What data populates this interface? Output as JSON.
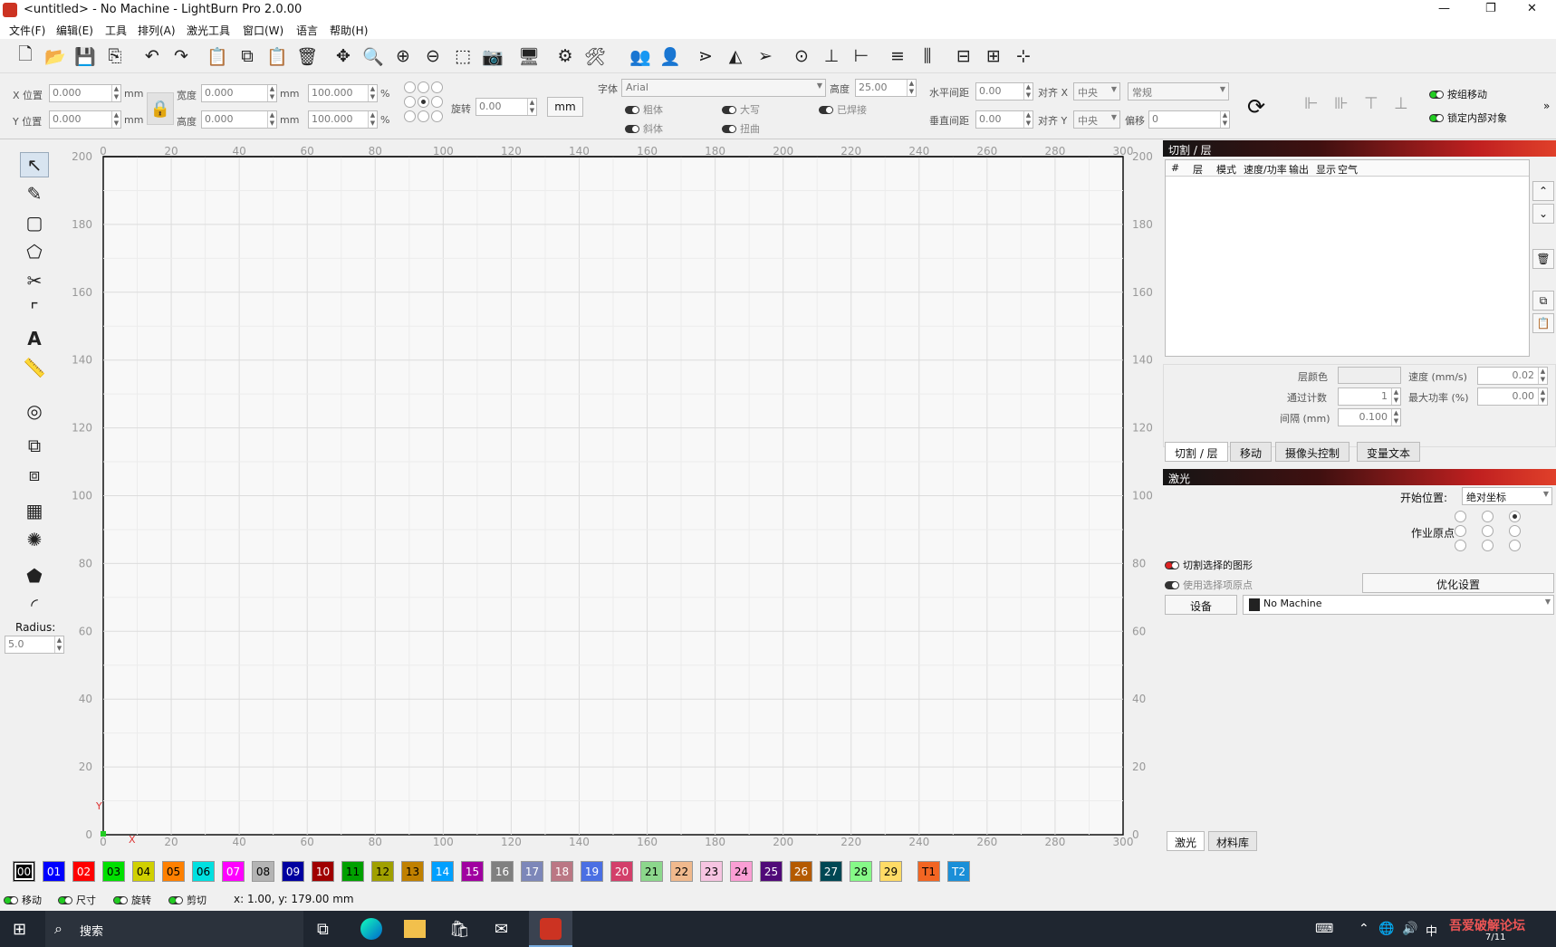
{
  "title": "<untitled> - No Machine - LightBurn Pro 2.0.00",
  "window_controls": {
    "minimize": "—",
    "maximize": "❐",
    "close": "✕"
  },
  "menu": [
    "文件(F)",
    "编辑(E)",
    "工具",
    "排列(A)",
    "激光工具",
    "窗口(W)",
    "语言",
    "帮助(H)"
  ],
  "props": {
    "x_label": "X 位置",
    "x_value": "0.000",
    "y_label": "Y 位置",
    "y_value": "0.000",
    "unit_mm": "mm",
    "width_label": "宽度",
    "width_value": "0.000",
    "height_label": "高度",
    "height_value": "0.000",
    "scale_x": "100.000",
    "scale_y": "100.000",
    "percent": "%",
    "rotate_label": "旋转",
    "rotate_value": "0.00",
    "mm_button": "mm",
    "font_label": "字体",
    "font_value": "Arial",
    "font_height_label": "高度",
    "font_height_value": "25.00",
    "bold": "粗体",
    "italic": "斜体",
    "upper": "大写",
    "distort": "扭曲",
    "welded": "已焊接",
    "hspace_label": "水平间距",
    "hspace_value": "0.00",
    "vspace_label": "垂直间距",
    "vspace_value": "0.00",
    "alignx_label": "对齐 X",
    "alignx_value": "中央",
    "aligny_label": "对齐 Y",
    "aligny_value": "中央",
    "style_value": "常规",
    "offset_label": "偏移",
    "offset_value": "0",
    "group_move": "按组移动",
    "lock_inner": "锁定内部对象"
  },
  "left_tools": {
    "radius_label": "Radius:",
    "radius_value": "5.0"
  },
  "canvas": {
    "x_ticks": [
      "0",
      "20",
      "40",
      "60",
      "80",
      "100",
      "120",
      "140",
      "160",
      "180",
      "200",
      "220",
      "240",
      "260",
      "280",
      "300"
    ],
    "y_ticks": [
      "200",
      "180",
      "160",
      "140",
      "120",
      "100",
      "80",
      "60",
      "40",
      "20",
      "0"
    ],
    "x_axis": "X",
    "y_axis": "Y"
  },
  "cuts_panel": {
    "title": "切割 / 层",
    "columns": [
      "#",
      "层",
      "模式",
      "速度/功率",
      "输出",
      "显示",
      "空气"
    ],
    "layer_color_label": "层颜色",
    "speed_label": "速度 (mm/s)",
    "speed_value": "0.02",
    "passes_label": "通过计数",
    "passes_value": "1",
    "power_label": "最大功率 (%)",
    "power_value": "0.00",
    "interval_label": "间隔 (mm)",
    "interval_value": "0.100",
    "tabs": [
      "切割 / 层",
      "移动",
      "摄像头控制",
      "变量文本"
    ]
  },
  "laser_panel": {
    "title": "激光",
    "start_from_label": "开始位置:",
    "start_from_value": "绝对坐标",
    "job_origin_label": "作业原点",
    "cut_selected": "切割选择的图形",
    "use_selection_origin": "使用选择项原点",
    "optimize_button": "优化设置",
    "devices_button": "设备",
    "device_value": "No Machine",
    "tabs": [
      "激光",
      "材料库"
    ]
  },
  "palette": [
    {
      "label": "00",
      "color": "#000000",
      "fg": "#ffffff"
    },
    {
      "label": "01",
      "color": "#0000ff",
      "fg": "#ffffff"
    },
    {
      "label": "02",
      "color": "#ff0000",
      "fg": "#ffffff"
    },
    {
      "label": "03",
      "color": "#00e000",
      "fg": "#000000"
    },
    {
      "label": "04",
      "color": "#d0d000",
      "fg": "#000000"
    },
    {
      "label": "05",
      "color": "#ff8000",
      "fg": "#000000"
    },
    {
      "label": "06",
      "color": "#00e0e0",
      "fg": "#000000"
    },
    {
      "label": "07",
      "color": "#ff00ff",
      "fg": "#ffffff"
    },
    {
      "label": "08",
      "color": "#b4b4b4",
      "fg": "#000000"
    },
    {
      "label": "09",
      "color": "#0000a0",
      "fg": "#ffffff"
    },
    {
      "label": "10",
      "color": "#a00000",
      "fg": "#ffffff"
    },
    {
      "label": "11",
      "color": "#00a000",
      "fg": "#000000"
    },
    {
      "label": "12",
      "color": "#a0a000",
      "fg": "#000000"
    },
    {
      "label": "13",
      "color": "#c08000",
      "fg": "#000000"
    },
    {
      "label": "14",
      "color": "#00a0ff",
      "fg": "#ffffff"
    },
    {
      "label": "15",
      "color": "#a000a0",
      "fg": "#ffffff"
    },
    {
      "label": "16",
      "color": "#808080",
      "fg": "#ffffff"
    },
    {
      "label": "17",
      "color": "#7d87b9",
      "fg": "#ffffff"
    },
    {
      "label": "18",
      "color": "#bb7784",
      "fg": "#ffffff"
    },
    {
      "label": "19",
      "color": "#4a6fe3",
      "fg": "#ffffff"
    },
    {
      "label": "20",
      "color": "#d33f6a",
      "fg": "#ffffff"
    },
    {
      "label": "21",
      "color": "#8cd78c",
      "fg": "#000000"
    },
    {
      "label": "22",
      "color": "#f0b98d",
      "fg": "#000000"
    },
    {
      "label": "23",
      "color": "#f6c4e1",
      "fg": "#000000"
    },
    {
      "label": "24",
      "color": "#fa9ed4",
      "fg": "#000000"
    },
    {
      "label": "25",
      "color": "#500a78",
      "fg": "#ffffff"
    },
    {
      "label": "26",
      "color": "#b45a00",
      "fg": "#ffffff"
    },
    {
      "label": "27",
      "color": "#004754",
      "fg": "#ffffff"
    },
    {
      "label": "28",
      "color": "#86fa88",
      "fg": "#000000"
    },
    {
      "label": "29",
      "color": "#ffdb66",
      "fg": "#000000"
    },
    {
      "label": "T1",
      "color": "#f26522",
      "fg": "#000000"
    },
    {
      "label": "T2",
      "color": "#1a8fd8",
      "fg": "#ffffff"
    }
  ],
  "status": {
    "move": "移动",
    "size": "尺寸",
    "rotate": "旋转",
    "shear": "剪切",
    "coords": "x: 1.00, y: 179.00 mm"
  },
  "taskbar": {
    "search": "搜索",
    "ime": "中",
    "watermark": "吾爱破解论坛",
    "date": "7/11"
  }
}
